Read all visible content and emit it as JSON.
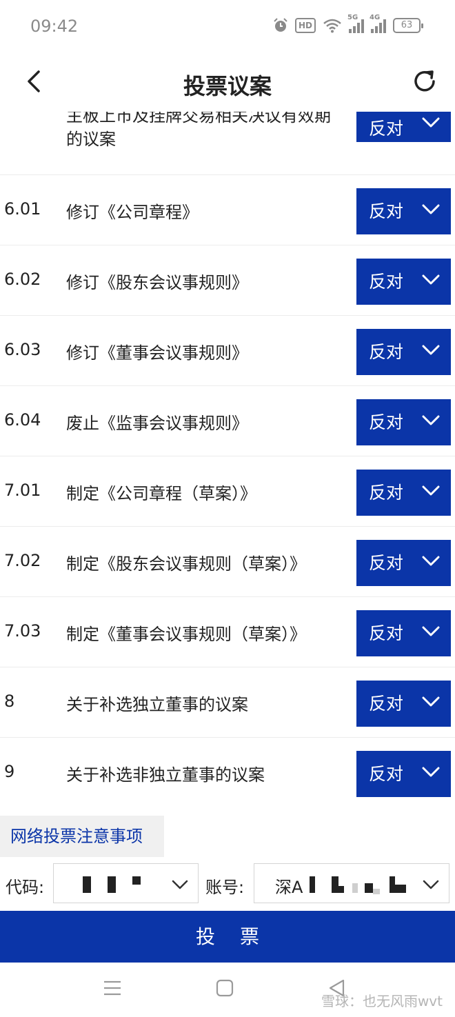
{
  "status": {
    "time": "09:42",
    "hd_label": "HD",
    "net1": "5G",
    "net2": "4G",
    "battery": "63"
  },
  "header": {
    "title": "投票议案"
  },
  "proposals": [
    {
      "num": "",
      "title": "开地方式在香港联合交易所有限公司主板上市及挂牌交易相关决议有效期的议案",
      "vote": "反对"
    },
    {
      "num": "6.01",
      "title": "修订《公司章程》",
      "vote": "反对"
    },
    {
      "num": "6.02",
      "title": "修订《股东会议事规则》",
      "vote": "反对"
    },
    {
      "num": "6.03",
      "title": "修订《董事会议事规则》",
      "vote": "反对"
    },
    {
      "num": "6.04",
      "title": "废止《监事会议事规则》",
      "vote": "反对"
    },
    {
      "num": "7.01",
      "title": "制定《公司章程（草案）》",
      "vote": "反对"
    },
    {
      "num": "7.02",
      "title": "制定《股东会议事规则（草案）》",
      "vote": "反对"
    },
    {
      "num": "7.03",
      "title": "制定《董事会议事规则（草案）》",
      "vote": "反对"
    },
    {
      "num": "8",
      "title": "关于补选独立董事的议案",
      "vote": "反对"
    },
    {
      "num": "9",
      "title": "关于补选非独立董事的议案",
      "vote": "反对"
    }
  ],
  "notice": {
    "label": "网络投票注意事项"
  },
  "form": {
    "code_label": "代码:",
    "account_label": "账号:",
    "account_prefix": "深A"
  },
  "vote_button": {
    "label": "投票"
  },
  "watermark": "雪球：也无风雨wvt",
  "colors": {
    "primary": "#0b35a8",
    "notice_bg": "#f0f0f0"
  }
}
